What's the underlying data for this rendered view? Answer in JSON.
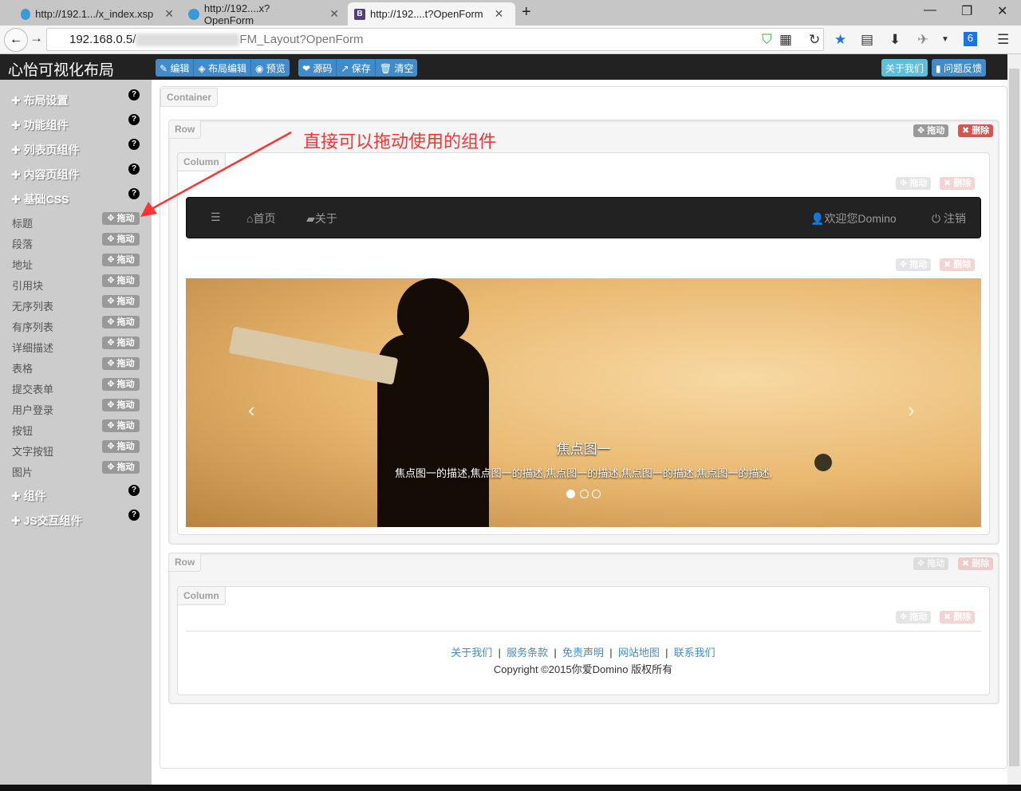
{
  "browser": {
    "tabs": [
      {
        "title": "http://192.1.../x_index.xsp"
      },
      {
        "title": "http://192....x?OpenForm"
      },
      {
        "title": "http://192....t?OpenForm",
        "active": true
      }
    ],
    "url_start": "192.168.0.5/",
    "url_end": "FM_Layout?OpenForm"
  },
  "app": {
    "brand": "心怡可视化布局",
    "toolbar1": [
      "编辑",
      "布局编辑",
      "预览"
    ],
    "toolbar2": [
      "源码",
      "保存",
      "清空"
    ],
    "about": "关于我们",
    "feedback": "问题反馈"
  },
  "sidebar": {
    "headers": [
      "布局设置",
      "功能组件",
      "列表页组件",
      "内容页组件",
      "基础CSS"
    ],
    "items": [
      "标题",
      "段落",
      "地址",
      "引用块",
      "无序列表",
      "有序列表",
      "详细描述",
      "表格",
      "提交表单",
      "用户登录",
      "按钮",
      "文字按钮",
      "图片"
    ],
    "drag": "拖动",
    "footer_headers": [
      "组件",
      "JS交互组件"
    ]
  },
  "canvas": {
    "container": "Container",
    "row": "Row",
    "column": "Column",
    "drag": "拖动",
    "delete": "删除",
    "annotation": "直接可以拖动使用的组件",
    "demo_nav": {
      "home": "首页",
      "about": "关于",
      "welcome": "欢迎您Domino",
      "logout": "注销"
    },
    "carousel": {
      "title": "焦点图一",
      "desc": "焦点图一的描述,焦点图一的描述,焦点图一的描述,焦点图一的描述,焦点图一的描述,",
      "active_index": 0,
      "count": 3
    },
    "footer": {
      "links": [
        "关于我们",
        "服务条款",
        "免责声明",
        "网站地图",
        "联系我们"
      ],
      "copyright": "Copyright ©2015你爱Domino 版权所有"
    }
  }
}
